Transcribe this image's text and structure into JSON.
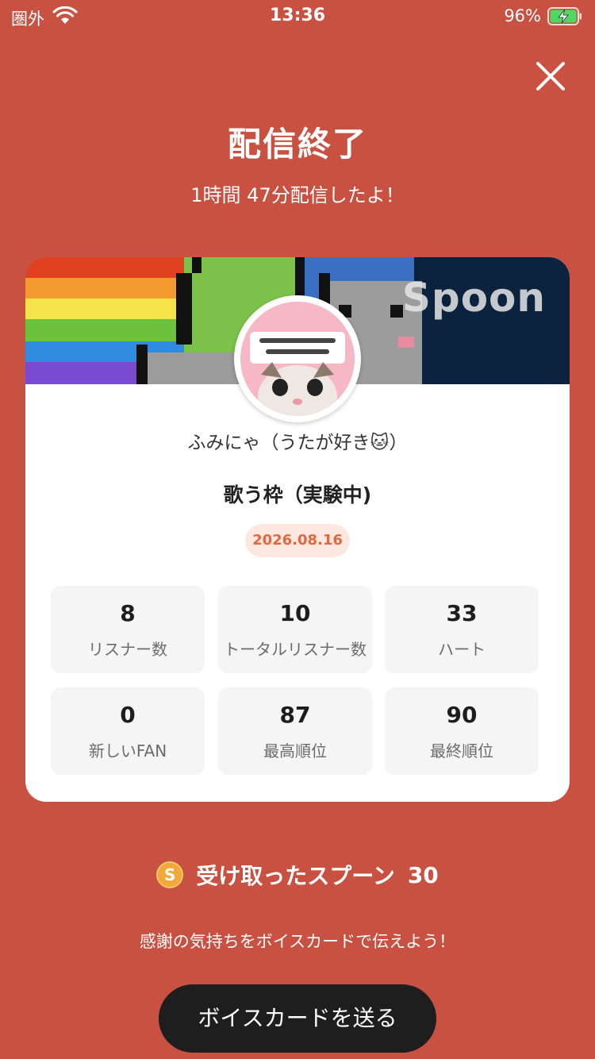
{
  "status_bar": {
    "carrier": "圏外",
    "time": "13:36",
    "battery": "96%"
  },
  "header": {
    "title": "配信終了",
    "subtitle": "1時間 47分配信したよ！"
  },
  "card": {
    "banner_logo": "Spoon",
    "dj_name": "ふみにゃ（うたが好き🐱）",
    "show_title": "歌う枠（実験中)",
    "date": "2026.08.16",
    "stats": [
      {
        "value": "8",
        "label": "リスナー数"
      },
      {
        "value": "10",
        "label": "トータルリスナー数"
      },
      {
        "value": "33",
        "label": "ハート"
      },
      {
        "value": "0",
        "label": "新しいFAN"
      },
      {
        "value": "87",
        "label": "最高順位"
      },
      {
        "value": "90",
        "label": "最終順位"
      }
    ]
  },
  "spoons": {
    "coin_letter": "S",
    "label": "受け取ったスプーン",
    "count": "30"
  },
  "thanks_text": "感謝の気持ちをボイスカードで伝えよう！",
  "voice_card_button": "ボイスカードを送る",
  "colors": {
    "background": "#c85141",
    "date_pill_bg": "#fde8e1",
    "date_pill_text": "#e1683f",
    "button": "#1e1e1e"
  }
}
